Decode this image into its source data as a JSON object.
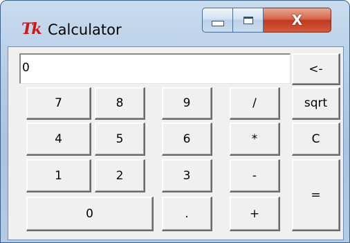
{
  "window": {
    "title": "Calculator",
    "icon_text": "Tk",
    "close_glyph": "X"
  },
  "display": {
    "value": "0"
  },
  "keys": {
    "backspace": "<-",
    "sqrt": "sqrt",
    "clear": "C",
    "equals": "=",
    "seven": "7",
    "eight": "8",
    "nine": "9",
    "divide": "/",
    "four": "4",
    "five": "5",
    "six": "6",
    "multiply": "*",
    "one": "1",
    "two": "2",
    "three": "3",
    "minus": "-",
    "zero": "0",
    "dot": ".",
    "plus": "+"
  },
  "colors": {
    "icon_red": "#d11414",
    "close_button": "#c0391f",
    "client_bg": "#f0f0f0"
  }
}
